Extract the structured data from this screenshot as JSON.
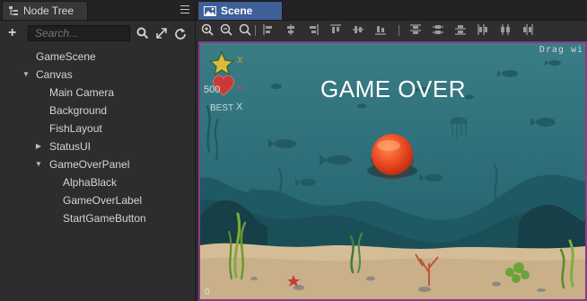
{
  "node_tree": {
    "tab_label": "Node Tree",
    "search_placeholder": "Search...",
    "items": [
      {
        "label": "GameScene",
        "depth": 0,
        "arrow": ""
      },
      {
        "label": "Canvas",
        "depth": 0,
        "arrow": "down"
      },
      {
        "label": "Main Camera",
        "depth": 1,
        "arrow": ""
      },
      {
        "label": "Background",
        "depth": 1,
        "arrow": ""
      },
      {
        "label": "FishLayout",
        "depth": 1,
        "arrow": ""
      },
      {
        "label": "StatusUI",
        "depth": 1,
        "arrow": "right"
      },
      {
        "label": "GameOverPanel",
        "depth": 1,
        "arrow": "down"
      },
      {
        "label": "AlphaBlack",
        "depth": 2,
        "arrow": ""
      },
      {
        "label": "GameOverLabel",
        "depth": 2,
        "arrow": ""
      },
      {
        "label": "StartGameButton",
        "depth": 2,
        "arrow": ""
      }
    ]
  },
  "scene": {
    "tab_label": "Scene",
    "drag_hint": "Drag wi",
    "game_over_text": "GAME OVER",
    "score_text": "500",
    "best_text": "BEST",
    "x_marker": "X",
    "axis_zero": "0"
  },
  "colors": {
    "accent_tab": "#3f5f97",
    "viewport_border": "#8b3a8b",
    "water_top": "#2f6f78",
    "water_bottom": "#1f5a66",
    "sand": "#d7c09a",
    "button_red": "#e8461f"
  }
}
